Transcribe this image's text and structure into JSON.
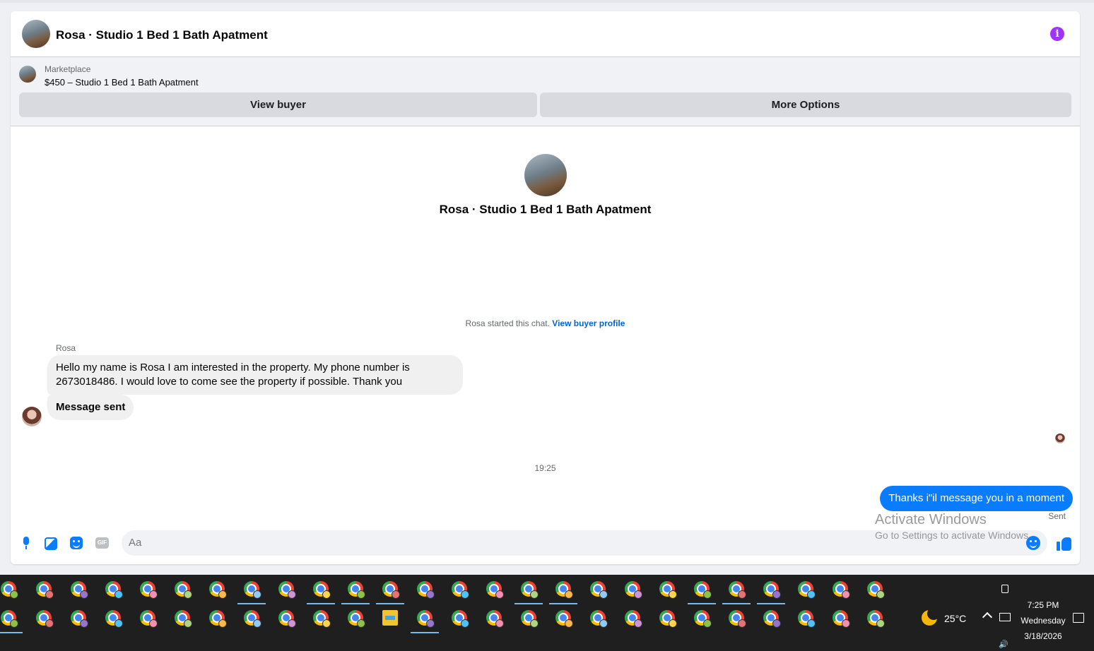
{
  "header": {
    "title": "Rosa · Studio 1 Bed 1 Bath Apatment",
    "info_icon": "info-icon"
  },
  "marketplace": {
    "label": "Marketplace",
    "listing": "$450 – Studio 1 Bed 1 Bath Apatment",
    "view_buyer": "View buyer",
    "more_options": "More Options"
  },
  "intro": {
    "title": "Rosa · Studio 1 Bed 1 Bath Apatment",
    "started_text": "Rosa started this chat.",
    "view_profile": "View buyer profile"
  },
  "messages": {
    "sender": "Rosa",
    "incoming_1": "Hello my name is Rosa I am interested in the property. My phone number is 2673018486. I would love to come see the property if possible. Thank you",
    "incoming_2": "Message sent",
    "timestamp": "19:25",
    "outgoing_1": "Thanks i\"il message you in a moment",
    "status": "Sent"
  },
  "composer": {
    "placeholder": "Aa",
    "gif_label": "GIF"
  },
  "watermark": {
    "line1": "Activate Windows",
    "line2": "Go to Settings to activate Windows."
  },
  "taskbar": {
    "temperature": "25°C",
    "time": "7:25 PM",
    "day": "Wednesday",
    "date": "3/18/2026",
    "volume_icon": "🔊"
  },
  "colors": {
    "accent": "#0a7cff",
    "info": "#a033ff",
    "taskbar": "#1f1f1f"
  }
}
